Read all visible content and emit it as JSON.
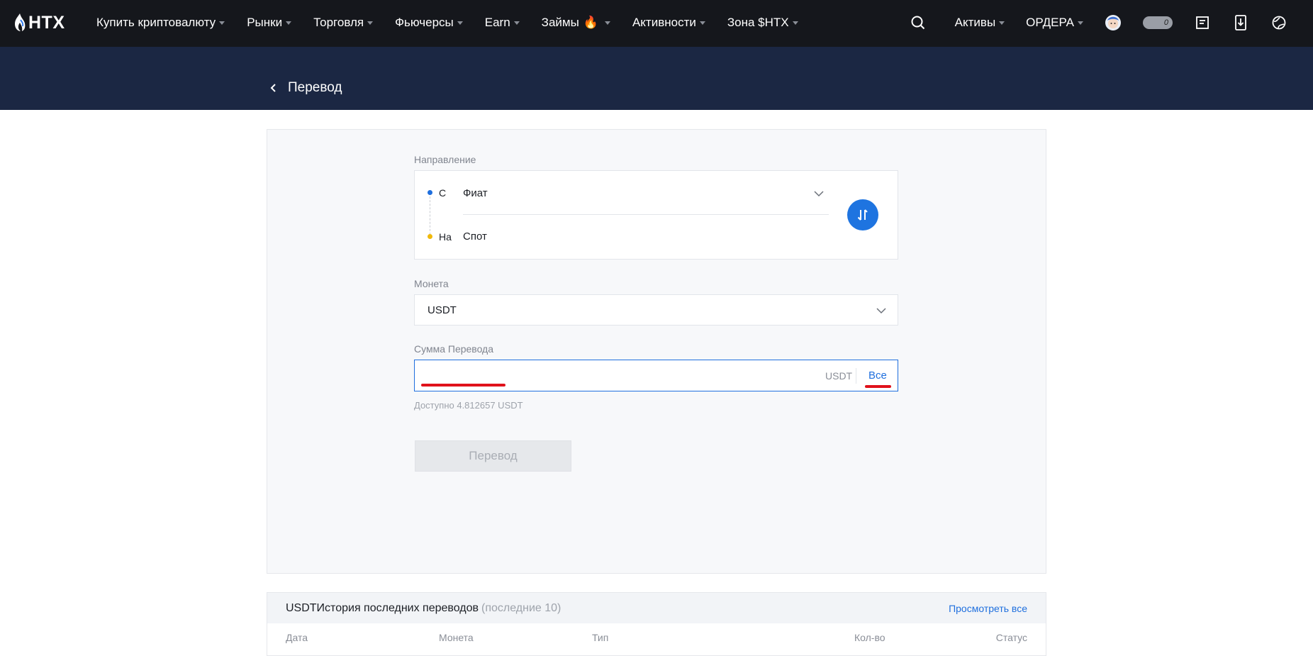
{
  "nav": {
    "logo_text": "HTX",
    "items": [
      {
        "label": "Купить криптовалюту"
      },
      {
        "label": "Рынки"
      },
      {
        "label": "Торговля"
      },
      {
        "label": "Фьючерсы"
      },
      {
        "label": "Earn"
      },
      {
        "label": "Займы"
      },
      {
        "label": "Активности"
      },
      {
        "label": "Зона $HTX"
      }
    ],
    "assets_label": "Активы",
    "orders_label": "ОРДЕРА",
    "toggle_count": "0"
  },
  "page": {
    "title": "Перевод"
  },
  "form": {
    "direction_label": "Направление",
    "from_key": "С",
    "from_value": "Фиат",
    "to_key": "На",
    "to_value": "Спот",
    "coin_label": "Монета",
    "coin_value": "USDT",
    "amount_label": "Сумма Перевода",
    "amount_value": "",
    "amount_unit": "USDT",
    "amount_all": "Все",
    "available_text": "Доступно 4.812657 USDT",
    "submit_label": "Перевод"
  },
  "history": {
    "title": "USDTИстория последних переводов",
    "note": "(последние 10)",
    "view_all": "Просмотреть все",
    "columns": [
      "Дата",
      "Монета",
      "Тип",
      "Кол-во",
      "Статус"
    ]
  },
  "colors": {
    "nav_bg": "#15171c",
    "band_bg": "#1b2743",
    "accent": "#1e74e0",
    "highlight_red": "#e0121b"
  }
}
